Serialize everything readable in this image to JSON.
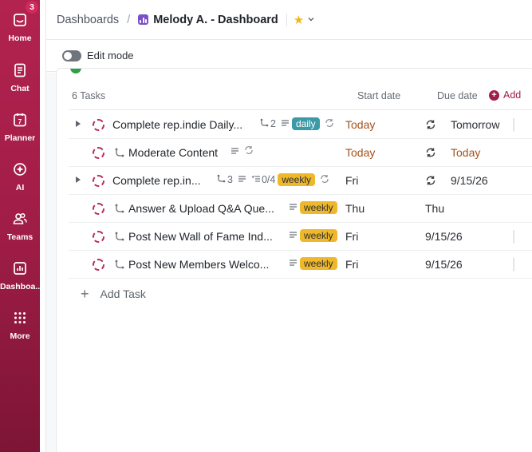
{
  "sidebar": {
    "items": [
      {
        "label": "Home",
        "icon": "home-icon",
        "badge": "3"
      },
      {
        "label": "Chat",
        "icon": "chat-icon"
      },
      {
        "label": "Planner",
        "icon": "calendar-icon",
        "icon_text": "7"
      },
      {
        "label": "AI",
        "icon": "ai-icon"
      },
      {
        "label": "Teams",
        "icon": "teams-icon"
      },
      {
        "label": "Dashboa..",
        "icon": "dashboard-icon"
      },
      {
        "label": "More",
        "icon": "grid-icon"
      }
    ]
  },
  "breadcrumb": {
    "root": "Dashboards",
    "separator": "/",
    "title": "Melody A. - Dashboard"
  },
  "toolbar": {
    "edit_mode_label": "Edit mode"
  },
  "table": {
    "count_label": "6 Tasks",
    "columns": {
      "start": "Start date",
      "due": "Due date"
    },
    "add_label": "Add",
    "rows": [
      {
        "name": "Complete rep.indie Daily...",
        "subtasks": "2",
        "tag": "daily",
        "start": "Today",
        "due": "Tomorrow"
      },
      {
        "name": "Moderate Content",
        "start": "Today",
        "due": "Today"
      },
      {
        "name": "Complete rep.in...",
        "subtasks": "3",
        "checklist": "0/4",
        "tag": "weekly",
        "start": "Fri",
        "due": "9/15/26"
      },
      {
        "name": "Answer & Upload Q&A Que...",
        "tag": "weekly",
        "start": "Thu",
        "due": "Thu"
      },
      {
        "name": "Post New Wall of Fame Ind...",
        "tag": "weekly",
        "start": "Fri",
        "due": "9/15/26"
      },
      {
        "name": "Post New Members Welco...",
        "tag": "weekly",
        "start": "Fri",
        "due": "9/15/26"
      }
    ],
    "add_task_label": "Add Task"
  },
  "colors": {
    "sidebar": "#a01d47",
    "accent": "#a01d47",
    "daily_tag": "#3c9aa6",
    "weekly_tag": "#efb82a",
    "date_orange": "#a3511a"
  }
}
